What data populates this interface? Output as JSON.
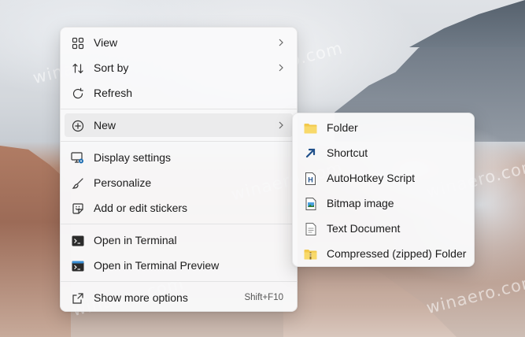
{
  "watermark": "winaero.com",
  "menu": {
    "items": [
      {
        "label": "View",
        "icon": "grid-icon"
      },
      {
        "label": "Sort by",
        "icon": "sort-icon"
      },
      {
        "label": "Refresh",
        "icon": "refresh-icon"
      },
      {
        "label": "New",
        "icon": "plus-circle-icon"
      },
      {
        "label": "Display settings",
        "icon": "display-settings-icon"
      },
      {
        "label": "Personalize",
        "icon": "brush-icon"
      },
      {
        "label": "Add or edit stickers",
        "icon": "sticker-icon"
      },
      {
        "label": "Open in Terminal",
        "icon": "terminal-icon"
      },
      {
        "label": "Open in Terminal Preview",
        "icon": "terminal-preview-icon"
      },
      {
        "label": "Show more options",
        "icon": "share-icon",
        "shortcut": "Shift+F10"
      }
    ]
  },
  "submenu": {
    "items": [
      {
        "label": "Folder",
        "icon": "folder-icon"
      },
      {
        "label": "Shortcut",
        "icon": "shortcut-arrow-icon"
      },
      {
        "label": "AutoHotkey Script",
        "icon": "autohotkey-icon"
      },
      {
        "label": "Bitmap image",
        "icon": "bitmap-icon"
      },
      {
        "label": "Text Document",
        "icon": "text-document-icon"
      },
      {
        "label": "Compressed (zipped) Folder",
        "icon": "zip-folder-icon"
      }
    ]
  },
  "colors": {
    "menu_bg": "#f9f9fa",
    "highlight": "#ebebec",
    "folder": "#f2c94c",
    "accent_blue": "#1f6fb2"
  }
}
